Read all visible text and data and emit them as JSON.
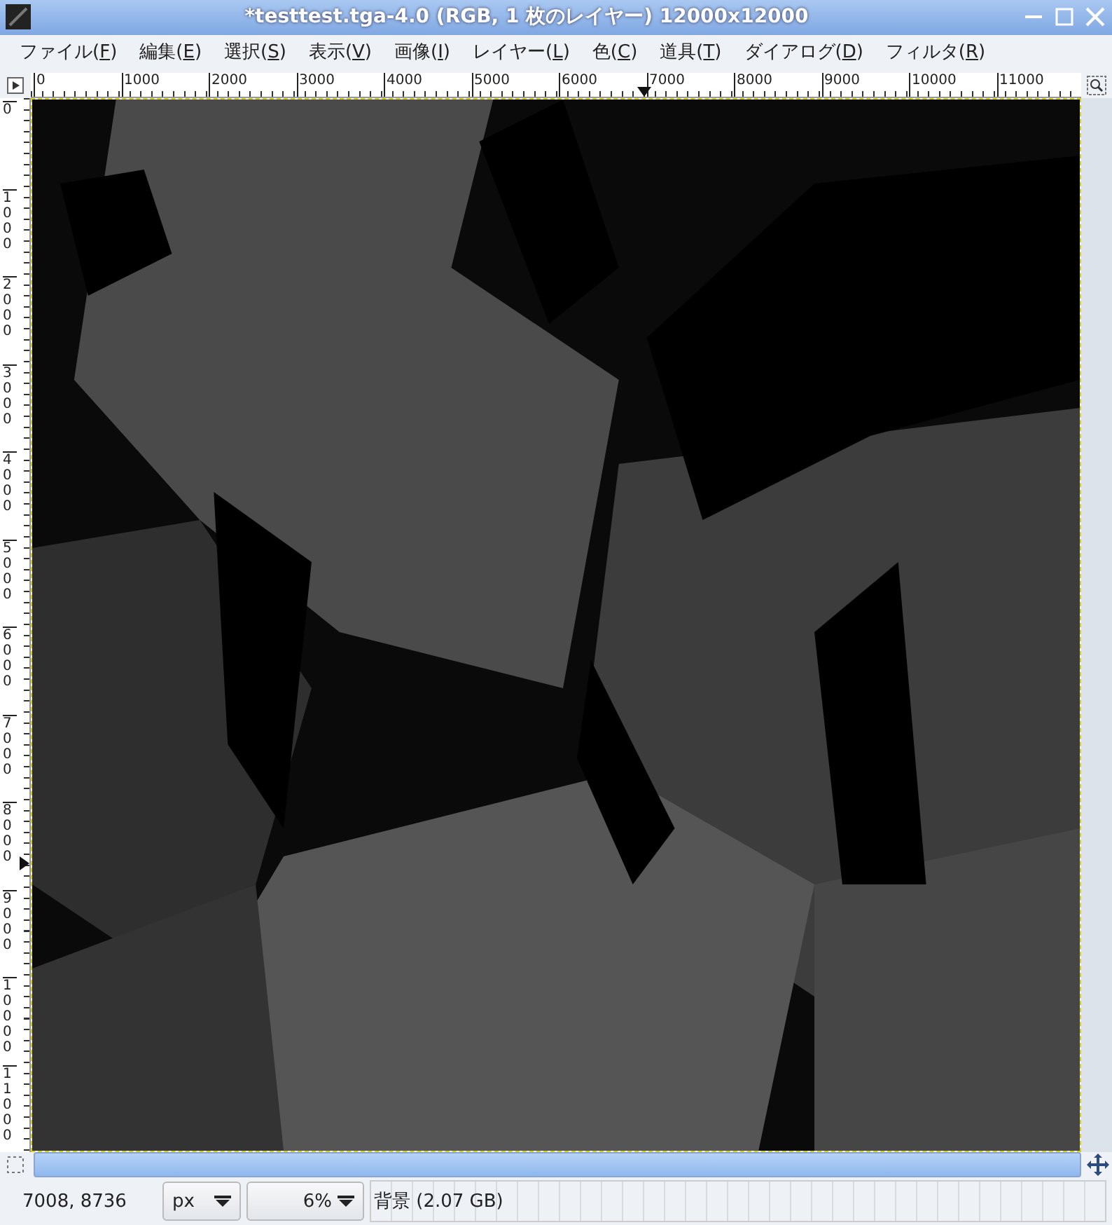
{
  "window": {
    "title": "*testtest.tga-4.0 (RGB, 1 枚のレイヤー) 12000x12000"
  },
  "menu": [
    {
      "text": "ファイル(",
      "key": "F",
      "end": ")"
    },
    {
      "text": "編集(",
      "key": "E",
      "end": ")"
    },
    {
      "text": "選択(",
      "key": "S",
      "end": ")"
    },
    {
      "text": "表示(",
      "key": "V",
      "end": ")"
    },
    {
      "text": "画像(",
      "key": "I",
      "end": ")"
    },
    {
      "text": "レイヤー(",
      "key": "L",
      "end": ")"
    },
    {
      "text": "色(",
      "key": "C",
      "end": ")"
    },
    {
      "text": "道具(",
      "key": "T",
      "end": ")"
    },
    {
      "text": "ダイアログ(",
      "key": "D",
      "end": ")"
    },
    {
      "text": "フィルタ(",
      "key": "R",
      "end": ")"
    }
  ],
  "horizontal_ruler": {
    "labels": [
      "0",
      "1000",
      "2000",
      "3000",
      "4000",
      "5000",
      "6000",
      "7000",
      "8000",
      "9000",
      "10000",
      "11000"
    ]
  },
  "vertical_ruler": {
    "labels": [
      "0",
      "1000",
      "2000",
      "3000",
      "4000",
      "5000",
      "6000",
      "7000",
      "8000",
      "9000",
      "10000",
      "11000"
    ]
  },
  "status_bar": {
    "coordinates": "7008, 8736",
    "unit": "px",
    "zoom": "6%",
    "layer_info": "背景 (2.07 GB)"
  }
}
